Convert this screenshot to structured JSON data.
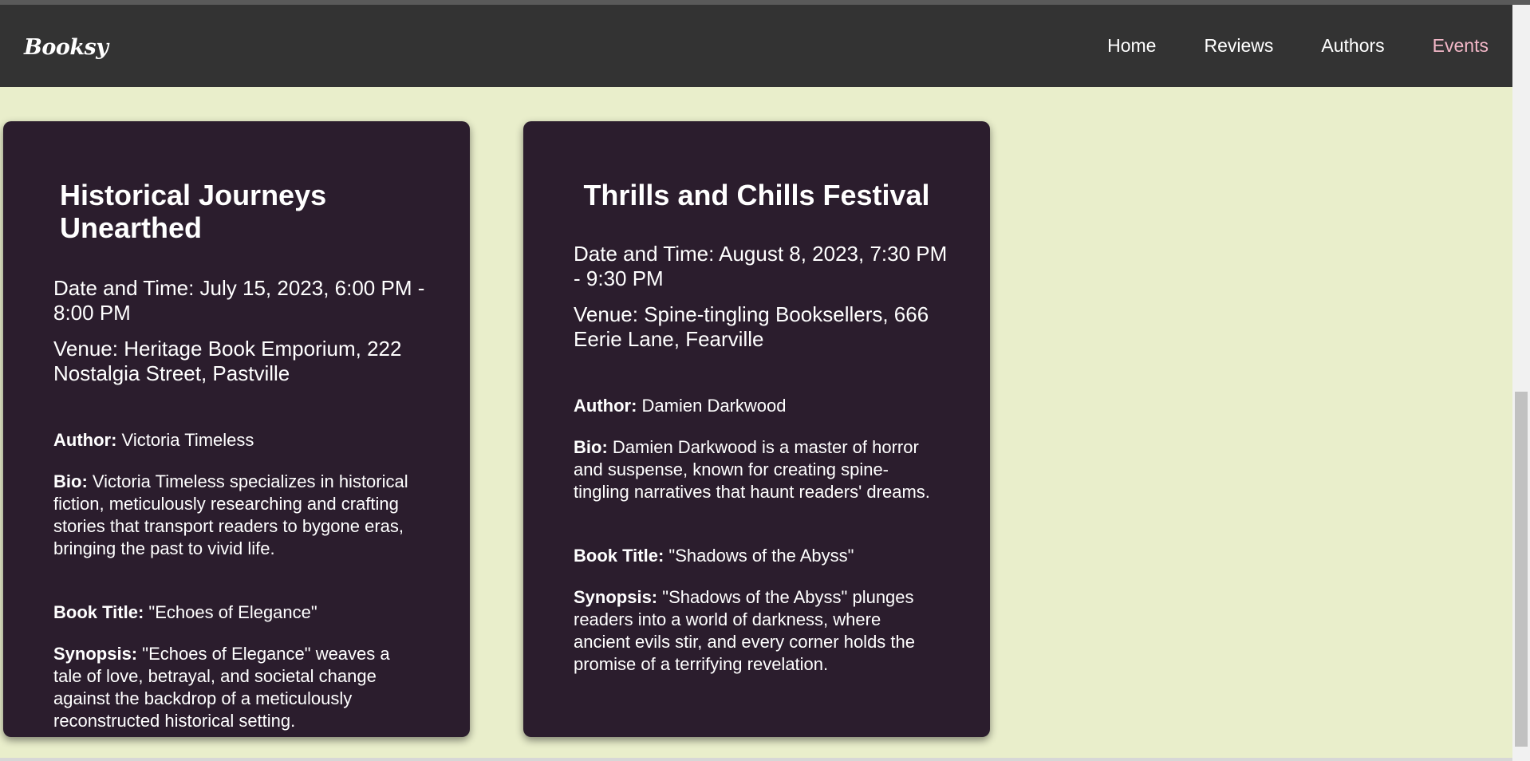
{
  "navbar": {
    "logo": "Booksy",
    "links": [
      {
        "label": "Home"
      },
      {
        "label": "Reviews"
      },
      {
        "label": "Authors"
      },
      {
        "label": "Events",
        "active": true
      }
    ]
  },
  "events": [
    {
      "title": "Historical Journeys Unearthed",
      "date_time": "Date and Time: July 15, 2023, 6:00 PM - 8:00 PM",
      "venue": "Venue: Heritage Book Emporium, 222 Nostalgia Street, Pastville",
      "author_label": "Author:",
      "author": "Victoria Timeless",
      "bio_label": "Bio:",
      "bio": "Victoria Timeless specializes in historical fiction, meticulously researching and crafting stories that transport readers to bygone eras, bringing the past to vivid life.",
      "book_title_label": "Book Title:",
      "book_title": "\"Echoes of Elegance\"",
      "synopsis_label": "Synopsis:",
      "synopsis": "\"Echoes of Elegance\" weaves a tale of love, betrayal, and societal change against the backdrop of a meticulously reconstructed historical setting."
    },
    {
      "title": "Thrills and Chills Festival",
      "date_time": "Date and Time: August 8, 2023, 7:30 PM - 9:30 PM",
      "venue": "Venue: Spine-tingling Booksellers, 666 Eerie Lane, Fearville",
      "author_label": "Author:",
      "author": "Damien Darkwood",
      "bio_label": "Bio:",
      "bio": "Damien Darkwood is a master of horror and suspense, known for creating spine-tingling narratives that haunt readers' dreams.",
      "book_title_label": "Book Title:",
      "book_title": "\"Shadows of the Abyss\"",
      "synopsis_label": "Synopsis:",
      "synopsis": "\"Shadows of the Abyss\" plunges readers into a world of darkness, where ancient evils stir, and every corner holds the promise of a terrifying revelation."
    }
  ],
  "colors": {
    "page_background": "#e9eecb",
    "navbar": "#333333",
    "card": "#2b1d2d",
    "active_link": "#f2b7c7"
  }
}
